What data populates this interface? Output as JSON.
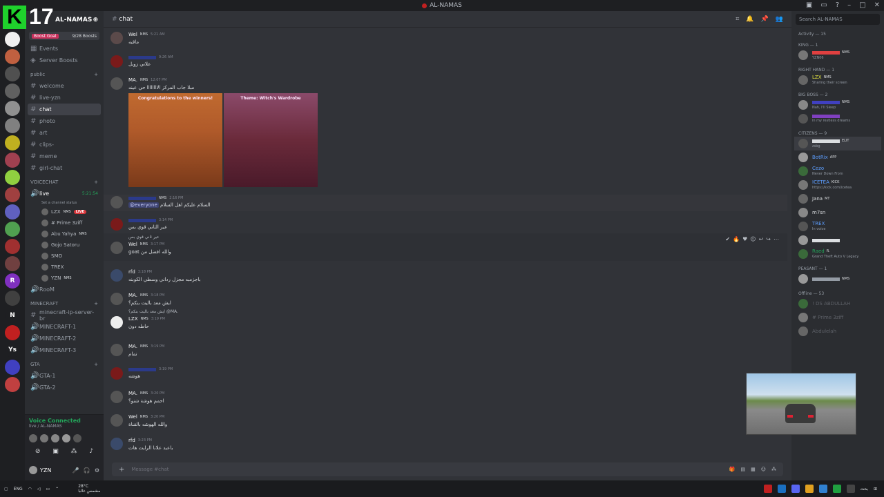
{
  "titlebar": {
    "title": "AL-NAMAS"
  },
  "overlay": {
    "logo_letter": "K",
    "logo_number": "17"
  },
  "rail": [
    {
      "label": "",
      "color": "#f0f0f0"
    },
    {
      "label": "",
      "color": "#c06040"
    },
    {
      "label": "",
      "color": "#505050"
    },
    {
      "label": "",
      "color": "#606060"
    },
    {
      "label": "",
      "color": "#909090"
    },
    {
      "label": "",
      "color": "#808080"
    },
    {
      "label": "",
      "color": "#c0b020"
    },
    {
      "label": "",
      "color": "#a04050"
    },
    {
      "label": "",
      "color": "#90d040"
    },
    {
      "label": "",
      "color": "#a04040"
    },
    {
      "label": "",
      "color": "#6060c0"
    },
    {
      "label": "",
      "color": "#50a050"
    },
    {
      "label": "",
      "color": "#a03030"
    },
    {
      "label": "",
      "color": "#704040"
    },
    {
      "label": "R",
      "color": "#8030c0"
    },
    {
      "label": "",
      "color": "#404040"
    },
    {
      "label": "N",
      "color": "#1e1f22"
    },
    {
      "label": "",
      "color": "#c02020"
    },
    {
      "label": "Ys",
      "color": "#1e1f22"
    },
    {
      "label": "",
      "color": "#4040c0"
    },
    {
      "label": "",
      "color": "#c04040"
    }
  ],
  "sidebar": {
    "server_name": "AL-NAMAS",
    "boost_goal": "Boost Goal",
    "boost_count": "9/28 Boosts",
    "top_items": [
      "Events",
      "Server Boosts"
    ],
    "cat_public": "public",
    "channels_public": [
      {
        "name": "welcome",
        "active": false
      },
      {
        "name": "live-yzn",
        "active": false
      },
      {
        "name": "chat",
        "active": true
      },
      {
        "name": "photo",
        "active": false
      },
      {
        "name": "art",
        "active": false
      },
      {
        "name": "clips-",
        "active": false
      },
      {
        "name": "meme",
        "active": false
      },
      {
        "name": "girl-chat",
        "active": false
      }
    ],
    "cat_voice": "VOICECHAT",
    "voice_live": "live",
    "voice_live_time": "5:21:54",
    "voice_status": "Set a channel status",
    "voice_users": [
      {
        "name": "LZX",
        "tag": "NMS",
        "live": "LIVE"
      },
      {
        "name": "# Prime 3ziff",
        "tag": "",
        "live": ""
      },
      {
        "name": "Abu Yahya",
        "tag": "NMS",
        "live": ""
      },
      {
        "name": "Gojo Satoru",
        "tag": "",
        "live": ""
      },
      {
        "name": "SMO",
        "tag": "",
        "live": ""
      },
      {
        "name": "TREX",
        "tag": "",
        "live": ""
      },
      {
        "name": "YZN",
        "tag": "NMS",
        "live": ""
      }
    ],
    "room": "RooM",
    "cat_minecraft": "MINECRAFT",
    "channels_minecraft": [
      "minecraft-ip-server-br",
      "MINECRAFT-1",
      "MINECRAFT-2",
      "MINECRAFT-3"
    ],
    "cat_gta": "GTA",
    "channels_gta": [
      "GTA-1",
      "GTA-2"
    ],
    "voice_connected": "Voice Connected",
    "voice_connected_sub": "live / AL-NAMAS",
    "user_name": "YZN"
  },
  "chat": {
    "channel": "chat",
    "composer_placeholder": "Message #chat",
    "messages": [
      {
        "name": "Wel",
        "badge": "NMS",
        "time": "5:21 AM",
        "text": "ماقيه"
      },
      {
        "name": "",
        "badge": "",
        "time": "9:26 AM",
        "text": "علاني زوبل"
      },
      {
        "name": "MA.",
        "badge": "NMS",
        "time": "12:07 PM",
        "text": "مبلا جاب المركز الاااااااا حي عينه"
      },
      {
        "name": "",
        "badge": "NMS",
        "time": "2:16 PM",
        "text": "السلام عليكم اهل السلام",
        "mention": "@everyone"
      },
      {
        "name": "",
        "badge": "",
        "time": "3:14 PM",
        "text": "عير الثاني قوي بس"
      },
      {
        "name": "Wel",
        "badge": "NMS",
        "time": "3:17 PM",
        "text": "goat والله افضل من",
        "reply": "عير ثاني قوي بس"
      },
      {
        "name": "rfd",
        "badge": "",
        "time": "3:18 PM",
        "text": "باجزمبه مجزل رداني وسطي الكوبنه"
      },
      {
        "name": "MA.",
        "badge": "NMS",
        "time": "3:18 PM",
        "text": "ايش معد باليت بنكم؟"
      },
      {
        "name": "LZX",
        "badge": "NMS",
        "time": "3:19 PM",
        "text": "حاطه دون",
        "reply": "ايش معد باليت بنكم؟ @MA."
      },
      {
        "name": "MA.",
        "badge": "NMS",
        "time": "3:19 PM",
        "text": "تمام"
      },
      {
        "name": "",
        "badge": "",
        "time": "3:19 PM",
        "text": "هوشه"
      },
      {
        "name": "MA.",
        "badge": "NMS",
        "time": "3:20 PM",
        "text": "احمم هوشة شنو؟"
      },
      {
        "name": "Wel",
        "badge": "NMS",
        "time": "3:20 PM",
        "text": "والله الهوشه بالقناة"
      },
      {
        "name": "rfd",
        "badge": "",
        "time": "3:23 PM",
        "text": "باعبد علانا الرايت هات"
      }
    ],
    "images": [
      {
        "caption": "Congratulations to the winners!"
      },
      {
        "caption": "Theme: Witch's Wardrobe"
      }
    ]
  },
  "members": {
    "search_placeholder": "Search AL-NAMAS",
    "activity": "Activity — 15",
    "groups": [
      {
        "label": "KING — 1",
        "items": [
          {
            "name": "",
            "status": "YZN06",
            "color": "#e04040",
            "tag": "NMS"
          }
        ]
      },
      {
        "label": "RIGHT HAND — 1",
        "items": [
          {
            "name": "LZX",
            "status": "Sharing their screen",
            "color": "#e0e040",
            "tag": "NMS"
          }
        ]
      },
      {
        "label": "BIG BOSS — 2",
        "items": [
          {
            "name": "",
            "status": "Nah, I'll Sleep",
            "color": "#4040c0",
            "tag": "NMS"
          },
          {
            "name": "",
            "status": "in my restless dreams",
            "color": "#8040c0",
            "tag": ""
          }
        ]
      },
      {
        "label": "CITIZENS — 9",
        "items": [
          {
            "name": "",
            "status": "zsbg",
            "color": "#dbdee1",
            "tag": "ELIT"
          },
          {
            "name": "BotRix",
            "status": "",
            "color": "#5c9eff",
            "tag": "APP"
          },
          {
            "name": "Cezo",
            "status": "Never Down From",
            "color": "#5c9eff",
            "tag": ""
          },
          {
            "name": "ICETEA",
            "status": "https://kick.com/icetea",
            "color": "#5c9eff",
            "tag": "KICK"
          },
          {
            "name": "Jana",
            "status": "",
            "color": "#dbdee1",
            "tag": "MT"
          },
          {
            "name": "m7sn",
            "status": "",
            "color": "#dbdee1",
            "tag": ""
          },
          {
            "name": "TREX",
            "status": "In voice",
            "color": "#5c9eff",
            "tag": ""
          },
          {
            "name": "",
            "status": "",
            "color": "#dbdee1",
            "tag": ""
          },
          {
            "name": "Raed",
            "status": "Grand Theft Auto V Legacy",
            "color": "#23a55a",
            "tag": "R."
          }
        ]
      },
      {
        "label": "PEASANT — 1",
        "items": [
          {
            "name": "",
            "status": "",
            "color": "#949ba4",
            "tag": "NMS"
          }
        ]
      },
      {
        "label": "Offline — 53",
        "items": [
          {
            "name": "! DS ABDULLAH",
            "status": "",
            "color": "#5e6168",
            "tag": ""
          },
          {
            "name": "# Prime 3ziff",
            "status": "",
            "color": "#5e6168",
            "tag": ""
          },
          {
            "name": "Abdulelah",
            "status": "",
            "color": "#5e6168",
            "tag": ""
          }
        ]
      }
    ]
  },
  "taskbar": {
    "lang": "ENG",
    "weather": "28°C",
    "weather_sub": "مشمس غالبا",
    "search": "بحث"
  }
}
